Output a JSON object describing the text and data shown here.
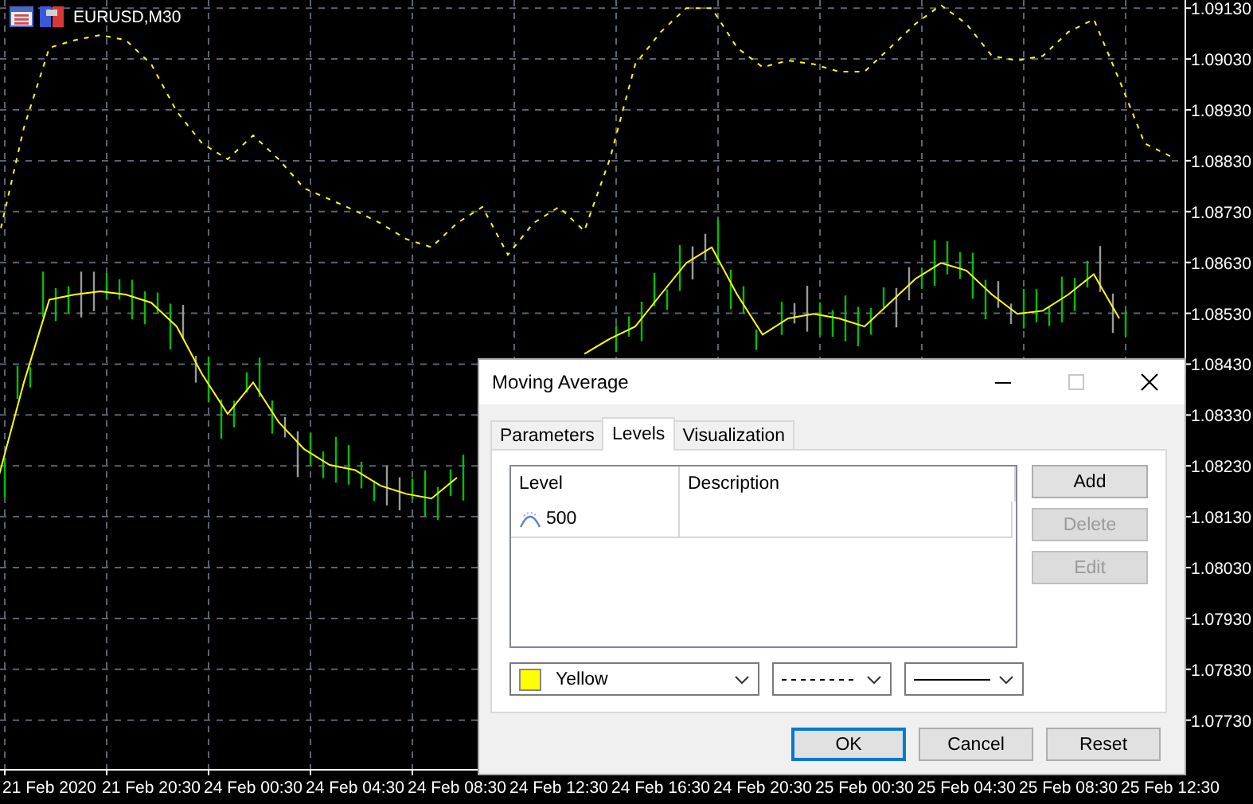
{
  "chart": {
    "title": "EURUSD,M30",
    "chart_data": {
      "type": "line",
      "grid": true,
      "categories": [
        null,
        null,
        "21 Feb 2020",
        null,
        null,
        null,
        "21 Feb 20:30",
        null,
        null,
        null,
        "24 Feb 00:30",
        null,
        null,
        null,
        "24 Feb 04:30",
        null,
        null,
        null,
        "24 Feb 08:30",
        null,
        null,
        null,
        "24 Feb 12:30",
        null,
        null,
        null,
        "24 Feb 16:30",
        null,
        null,
        null,
        "24 Feb 20:30",
        null,
        null,
        null,
        "25 Feb 00:30",
        null,
        null,
        null,
        "25 Feb 04:30",
        null,
        null,
        null,
        "25 Feb 08:30",
        null,
        null,
        null,
        "25 Feb 12:30"
      ],
      "series": [
        {
          "color": "#ffff00",
          "line_style": "solid",
          "values": [
            1.08207,
            1.08394,
            1.08557,
            1.08567,
            1.08573,
            1.08567,
            1.08551,
            1.08504,
            1.0841,
            1.08332,
            1.08394,
            1.08316,
            1.08263,
            1.08232,
            1.08222,
            1.08191,
            1.08175,
            1.08166,
            1.08207,
            null,
            null,
            null,
            null,
            1.0845,
            1.0848,
            1.08504,
            1.08567,
            1.08629,
            1.0866,
            1.08567,
            1.08488,
            1.0852,
            1.08529,
            1.0852,
            1.08504,
            1.08551,
            1.08598,
            1.08629,
            1.08614,
            1.08567,
            1.08529,
            1.08535,
            1.08567,
            1.08607,
            1.0852,
            null,
            null
          ]
        },
        {
          "color": "#ffff00",
          "line_style": "dashed",
          "values": [
            1.08676,
            1.08895,
            1.09052,
            1.09067,
            1.09077,
            1.09067,
            1.0902,
            1.08927,
            1.08864,
            1.08833,
            1.0888,
            1.08833,
            1.08776,
            1.08754,
            1.08732,
            1.08707,
            1.08676,
            1.0866,
            1.08707,
            1.08739,
            1.08645,
            1.08707,
            1.08739,
            1.08692,
            1.08833,
            1.0902,
            1.09083,
            1.0913,
            1.0913,
            1.09052,
            1.09014,
            1.09027,
            1.0902,
            1.09005,
            1.09005,
            1.09052,
            1.09099,
            1.09136,
            1.09099,
            1.09036,
            1.09027,
            1.09036,
            1.09083,
            1.09108,
            1.08989,
            1.08864,
            1.08839
          ]
        }
      ],
      "ylim": [
        1.07634,
        1.09146
      ],
      "yticks": [
        {
          "value": 1.0913,
          "label": "1.09130"
        },
        {
          "value": 1.0903,
          "label": "1.09030"
        },
        {
          "value": 1.0893,
          "label": "1.08930"
        },
        {
          "value": 1.0883,
          "label": "1.08830"
        },
        {
          "value": 1.0873,
          "label": "1.08730"
        },
        {
          "value": 1.0863,
          "label": "1.08630"
        },
        {
          "value": 1.0853,
          "label": "1.08530"
        },
        {
          "value": 1.0843,
          "label": "1.08430"
        },
        {
          "value": 1.0833,
          "label": "1.08330"
        },
        {
          "value": 1.0823,
          "label": "1.08230"
        },
        {
          "value": 1.0813,
          "label": "1.08130"
        },
        {
          "value": 1.0803,
          "label": "1.08030"
        },
        {
          "value": 1.0793,
          "label": "1.07930"
        },
        {
          "value": 1.0783,
          "label": "1.07830"
        },
        {
          "value": 1.0773,
          "label": "1.07730"
        }
      ]
    }
  },
  "dialog": {
    "title": "Moving Average",
    "tabs": [
      {
        "label": "Parameters",
        "selected": false
      },
      {
        "label": "Levels",
        "selected": true
      },
      {
        "label": "Visualization",
        "selected": false
      }
    ],
    "levels_table": {
      "columns": [
        "Level",
        "Description"
      ],
      "rows": [
        {
          "level": "500"
        }
      ]
    },
    "side_buttons": [
      {
        "label": "Add",
        "disabled": false
      },
      {
        "label": "Delete",
        "disabled": true
      },
      {
        "label": "Edit",
        "disabled": true
      }
    ],
    "selects": [
      {
        "kind": "color",
        "value": "Yellow"
      },
      {
        "kind": "dashed"
      },
      {
        "kind": "solid"
      }
    ],
    "buttons": [
      {
        "label": "OK",
        "default": true
      },
      {
        "label": "Cancel",
        "default": false
      },
      {
        "label": "Reset",
        "default": false
      }
    ]
  }
}
